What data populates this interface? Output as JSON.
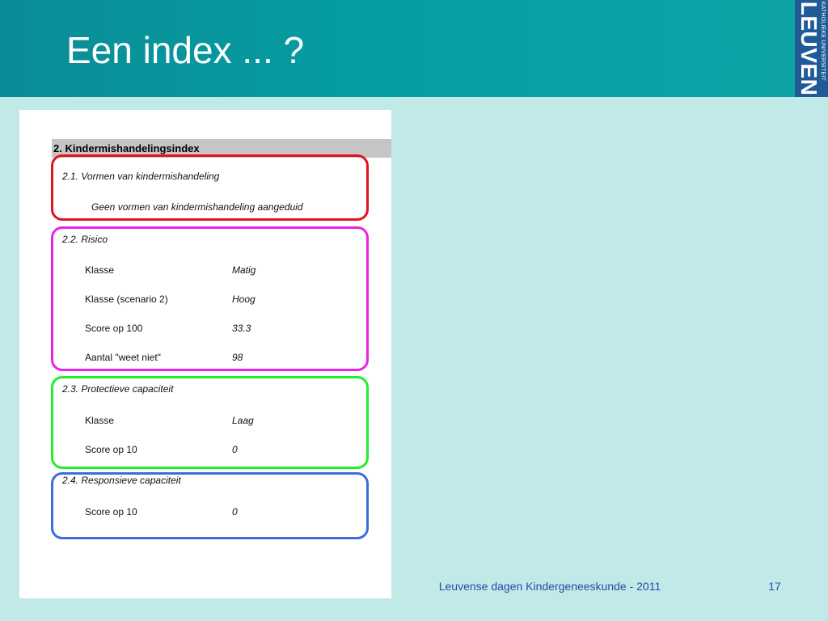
{
  "slide": {
    "title": "Een index ... ?",
    "logo": {
      "small_text": "KATHOLIEKE UNIVERSITEIT",
      "big_text": "LEUVEN"
    },
    "footer": "Leuvense dagen Kindergeneeskunde - 2011",
    "page_number": "17"
  },
  "document": {
    "header": "2. Kindermishandelingsindex",
    "sections": [
      {
        "title": "2.1. Vormen van kindermishandeling",
        "note": "Geen vormen van kindermishandeling aangeduid",
        "color": "#e0141e"
      },
      {
        "title": "2.2. Risico",
        "color": "#ea22e6",
        "rows": [
          {
            "label": "Klasse",
            "value": "Matig"
          },
          {
            "label": "Klasse (scenario 2)",
            "value": "Hoog"
          },
          {
            "label": "Score op 100",
            "value": "33.3"
          },
          {
            "label": "Aantal \"weet niet\"",
            "value": "98"
          }
        ]
      },
      {
        "title": "2.3. Protectieve capaciteit",
        "color": "#22ee2a",
        "rows": [
          {
            "label": "Klasse",
            "value": "Laag"
          },
          {
            "label": "Score op 10",
            "value": "0"
          }
        ]
      },
      {
        "title": "2.4. Responsieve capaciteit",
        "color": "#3b6edc",
        "rows": [
          {
            "label": "Score op 10",
            "value": "0"
          }
        ]
      }
    ]
  },
  "colors": {
    "header_bar": "#049ea2",
    "background": "#c0e9e8",
    "logo_background": "#1f5c97",
    "footer_text": "#2a4aa8"
  }
}
